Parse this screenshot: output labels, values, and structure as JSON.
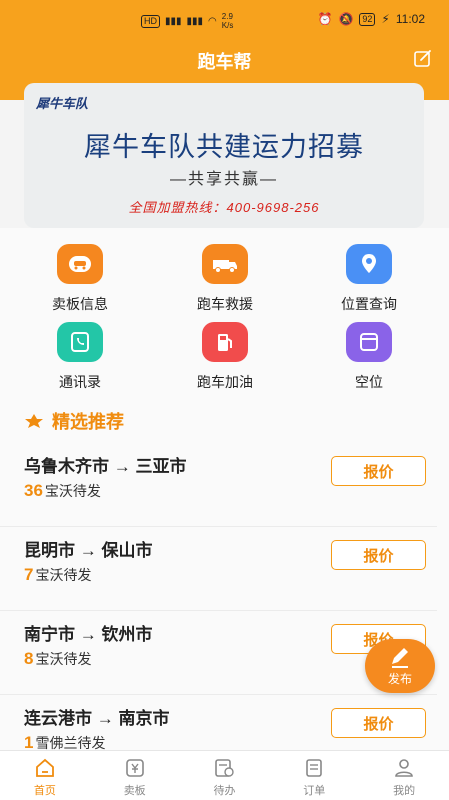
{
  "status_bar": {
    "hd": "HD",
    "speed_value": "2.9",
    "speed_unit": "K/s",
    "battery": "92",
    "time": "11:02"
  },
  "app_title": "跑车帮",
  "banner": {
    "logo": "犀牛车队",
    "headline": "犀牛车队共建运力招募",
    "subline": "—共享共赢—",
    "hotline": "全国加盟热线：400-9698-256"
  },
  "grid": [
    {
      "label": "卖板信息",
      "icon": "car-icon",
      "color": "#f5871f"
    },
    {
      "label": "跑车救援",
      "icon": "truck-icon",
      "color": "#f5871f"
    },
    {
      "label": "位置查询",
      "icon": "location-icon",
      "color": "#4a90f5"
    },
    {
      "label": "通讯录",
      "icon": "phone-icon",
      "color": "#23c6a7"
    },
    {
      "label": "跑车加油",
      "icon": "fuel-icon",
      "color": "#f14c4c"
    },
    {
      "label": "空位",
      "icon": "seat-icon",
      "color": "#8a63e8"
    }
  ],
  "section_title": "精选推荐",
  "routes": [
    {
      "name": "乌鲁木齐市 → 三亚市",
      "count": "36",
      "suffix": "宝沃待发",
      "button": "报价"
    },
    {
      "name": "昆明市 → 保山市",
      "count": "7",
      "suffix": "宝沃待发",
      "button": "报价"
    },
    {
      "name": "南宁市 → 钦州市",
      "count": "8",
      "suffix": "宝沃待发",
      "button": "报价"
    },
    {
      "name": "连云港市 → 南京市",
      "count": "1",
      "suffix": "雪佛兰待发",
      "button": "报价"
    }
  ],
  "fab_label": "发布",
  "tabs": [
    {
      "label": "首页",
      "icon": "home-icon",
      "active": true
    },
    {
      "label": "卖板",
      "icon": "sell-icon",
      "active": false
    },
    {
      "label": "待办",
      "icon": "todo-icon",
      "active": false
    },
    {
      "label": "订单",
      "icon": "order-icon",
      "active": false
    },
    {
      "label": "我的",
      "icon": "profile-icon",
      "active": false
    }
  ],
  "colors": {
    "brand": "#f7a21d",
    "accent": "#f08c0f",
    "tab_active": "#f08c0f"
  }
}
